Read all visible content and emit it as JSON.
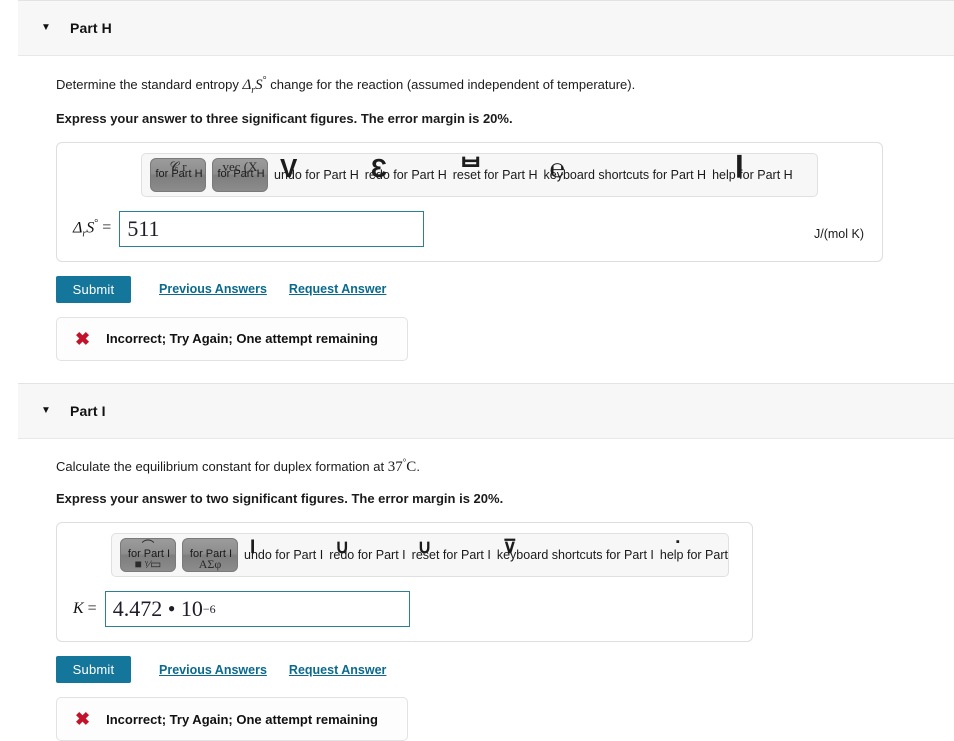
{
  "parts": [
    {
      "id": "h",
      "caret": "▼",
      "title": "Part H",
      "question": "Determine the standard entropy ",
      "question_math": "Δ",
      "question_math_sub": "r",
      "question_math_var": "S",
      "question_math_sup": "°",
      "question_tail": " change for the reaction (assumed independent of temperature).",
      "instruction": "Express your answer to three significant figures. The error margin is 20%.",
      "toolbar": {
        "template_buttons": [
          {
            "glyph_top": "𝒞  r",
            "glyph_low": "",
            "alt": "for Part H"
          },
          {
            "glyph_top": "vec  (X",
            "glyph_low": "",
            "alt": "for Part H"
          }
        ],
        "actions": [
          {
            "big": "V",
            "label": "undo for Part H",
            "cls": ""
          },
          {
            "big": "Ɛ",
            "label": "redo for Part H",
            "cls": ""
          },
          {
            "big": "ᄇ",
            "label": "reset for Part H",
            "cls": ""
          },
          {
            "big": "℮",
            "label": "keyboard shortcuts for Part H",
            "cls": ""
          },
          {
            "big": "❙",
            "label": "help for Part H",
            "cls": "bar"
          }
        ]
      },
      "answer_label_main": "Δ",
      "answer_label_sub": "r",
      "answer_label_var": "S",
      "answer_label_sup": "°",
      "answer_equals": "=",
      "answer_value": "511",
      "answer_value_sup": "",
      "units": "J/(mol K)",
      "submit_label": "Submit",
      "previous_answers_label": "Previous Answers",
      "request_answer_label": "Request Answer",
      "feedback_icon": "✖",
      "feedback_text": "Incorrect; Try Again; One attempt remaining"
    },
    {
      "id": "i",
      "caret": "▼",
      "title": "Part I",
      "question": "Calculate the equilibrium constant for duplex formation at ",
      "question_temp": "37",
      "question_temp_sup": "°",
      "question_temp_unit": "C",
      "question_tail": ".",
      "instruction": "Express your answer to two significant figures. The error margin is 20%.",
      "toolbar": {
        "template_buttons": [
          {
            "glyph_top": "⌒",
            "glyph_low": "■ ᵞ⁄▭",
            "alt": "for Part I"
          },
          {
            "glyph_top": "",
            "glyph_low": "ΑΣφ",
            "alt": "for Part I"
          }
        ],
        "actions": [
          {
            "big": "Ɩ",
            "label": "undo for Part I",
            "cls": "sm"
          },
          {
            "big": "∪",
            "label": "redo for Part I",
            "cls": "sm"
          },
          {
            "big": "∪",
            "label": "reset for Part I",
            "cls": "sm"
          },
          {
            "big": "⊽",
            "label": "keyboard shortcuts for Part I",
            "cls": "sm"
          },
          {
            "big": "▪",
            "label": "help for Part I",
            "cls": "dot"
          }
        ]
      },
      "answer_label_var": "K",
      "answer_equals": "=",
      "answer_value": "4.472 • 10",
      "answer_value_sup": "−6",
      "units": "",
      "submit_label": "Submit",
      "previous_answers_label": "Previous Answers",
      "request_answer_label": "Request Answer",
      "feedback_icon": "✖",
      "feedback_text": "Incorrect; Try Again; One attempt remaining"
    }
  ],
  "colors": {
    "submit_bg": "#14769a",
    "link": "#0a6a8e",
    "field_border": "#2d7f96",
    "error": "#c3132b",
    "header_bg": "#f7f7f7"
  }
}
